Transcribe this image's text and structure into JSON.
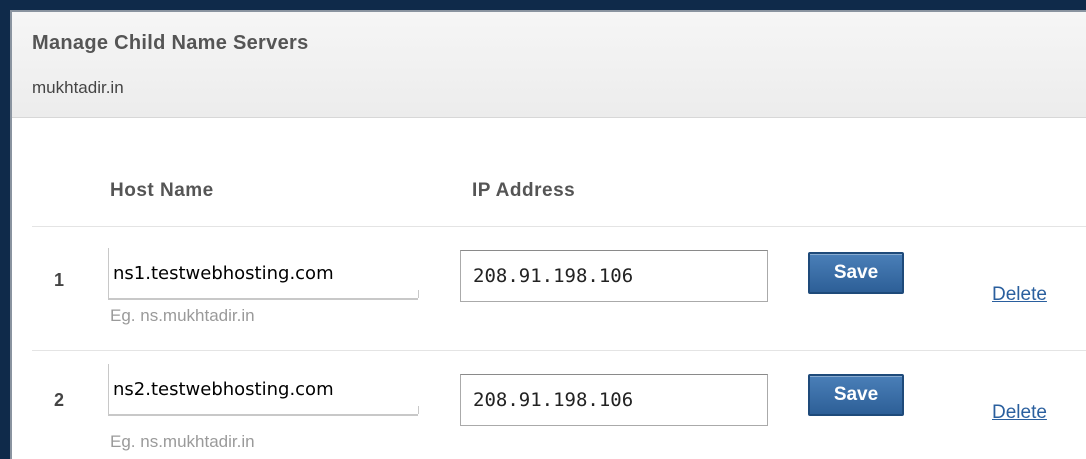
{
  "header": {
    "title": "Manage Child Name Servers",
    "domain": "mukhtadir.in"
  },
  "columns": {
    "host_name": "Host Name",
    "ip_address": "IP Address"
  },
  "rows": [
    {
      "number": "1",
      "host_value": "ns1.testwebhosting.com",
      "host_hint": "Eg. ns.mukhtadir.in",
      "ip_value": "208.91.198.106",
      "save_label": "Save",
      "delete_label": "Delete"
    },
    {
      "number": "2",
      "host_value": "ns2.testwebhosting.com",
      "host_hint": "Eg. ns.mukhtadir.in",
      "ip_value": "208.91.198.106",
      "save_label": "Save",
      "delete_label": "Delete"
    }
  ],
  "colors": {
    "frame": "#0f2a4a",
    "button": "#2d5f97",
    "link": "#2a5f9e"
  }
}
